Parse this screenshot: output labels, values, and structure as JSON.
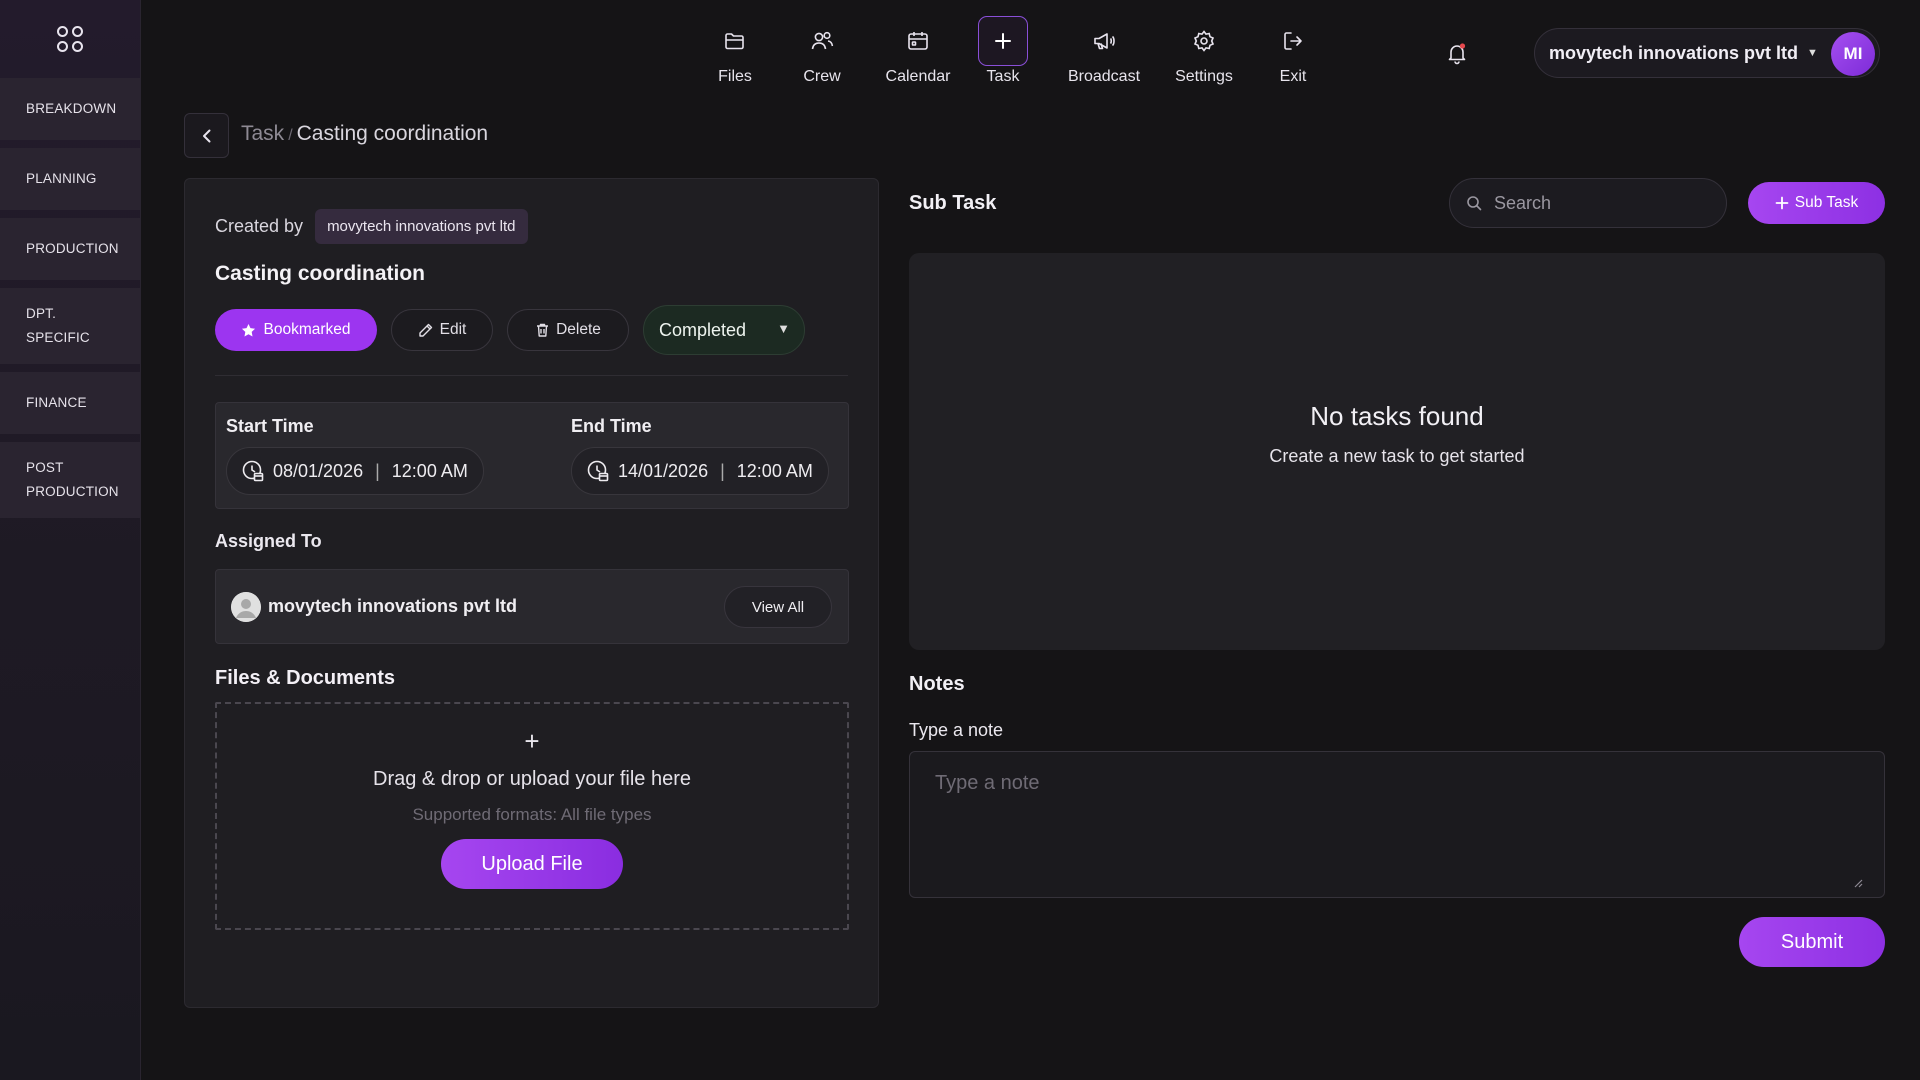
{
  "sidebar": {
    "logo_icon": "grid-apps-icon",
    "items": [
      {
        "label": "BREAKDOWN"
      },
      {
        "label": "PLANNING"
      },
      {
        "label": "PRODUCTION"
      },
      {
        "label": "DPT. SPECIFIC"
      },
      {
        "label": "FINANCE"
      },
      {
        "label": "POST PRODUCTION"
      }
    ]
  },
  "topnav": {
    "items": [
      {
        "label": "Files",
        "icon": "folder-icon"
      },
      {
        "label": "Crew",
        "icon": "crew-icon"
      },
      {
        "label": "Calendar",
        "icon": "calendar-icon"
      },
      {
        "label": "Task",
        "icon": "plus-icon",
        "active": true
      },
      {
        "label": "Broadcast",
        "icon": "megaphone-icon"
      },
      {
        "label": "Settings",
        "icon": "gear-icon"
      },
      {
        "label": "Exit",
        "icon": "exit-icon"
      }
    ]
  },
  "header": {
    "org_name": "movytech innovations pvt ltd",
    "avatar_initials": "MI",
    "notification_dot_color": "#e5484d"
  },
  "breadcrumb": {
    "parent": "Task",
    "separator": "/",
    "current": "Casting coordination"
  },
  "task": {
    "created_by_label": "Created by",
    "created_by": "movytech innovations pvt ltd",
    "title": "Casting coordination",
    "bookmark_label": "Bookmarked",
    "edit_label": "Edit",
    "delete_label": "Delete",
    "status": "Completed",
    "start_time_label": "Start Time",
    "start_date": "08/01/2026",
    "start_clock": "12:00 AM",
    "end_time_label": "End Time",
    "end_date": "14/01/2026",
    "end_clock": "12:00 AM",
    "assigned_label": "Assigned To",
    "assignee": "movytech innovations pvt ltd",
    "view_all_label": "View All",
    "files_label": "Files & Documents",
    "upload_title": "Drag & drop or upload your file here",
    "upload_sub": "Supported formats: All file types",
    "upload_button": "Upload File"
  },
  "subtask": {
    "title": "Sub Task",
    "search_placeholder": "Search",
    "add_label": "Sub Task",
    "empty_title": "No tasks found",
    "empty_sub": "Create a new task to get started"
  },
  "notes": {
    "title": "Notes",
    "label": "Type a note",
    "placeholder": "Type a note",
    "submit_label": "Submit"
  },
  "colors": {
    "accent": "#9c35f0",
    "status_bg": "#1c2a22",
    "background": "#151416"
  }
}
